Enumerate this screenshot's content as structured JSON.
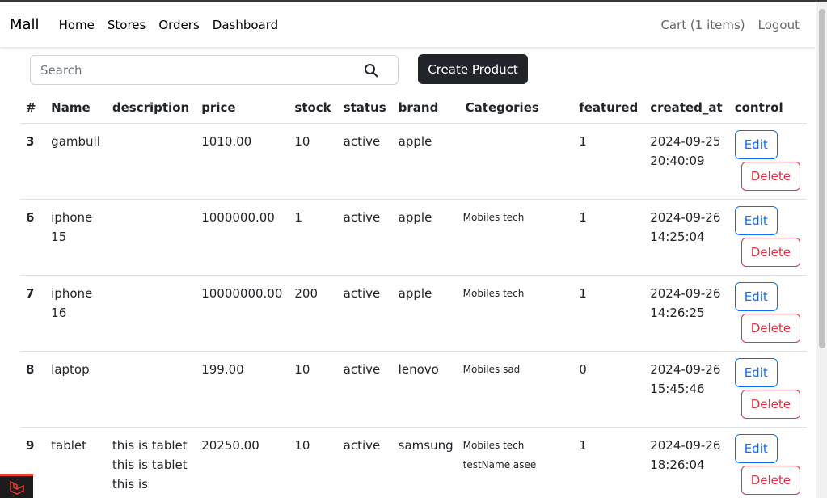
{
  "navbar": {
    "brand": "Mall",
    "links": [
      "Home",
      "Stores",
      "Orders",
      "Dashboard"
    ],
    "cart": "Cart (1 items)",
    "logout": "Logout"
  },
  "search": {
    "placeholder": "Search",
    "value": ""
  },
  "create_button": "Create Product",
  "table": {
    "headers": [
      "#",
      "Name",
      "description",
      "price",
      "stock",
      "status",
      "brand",
      "Categories",
      "featured",
      "created_at",
      "control"
    ],
    "rows": [
      {
        "id": "3",
        "name": "gambull",
        "description": "",
        "price": "1010.00",
        "stock": "10",
        "status": "active",
        "brand": "apple",
        "categories": "",
        "featured": "1",
        "created_at": "2024-09-25 20:40:09"
      },
      {
        "id": "6",
        "name": "iphone 15",
        "description": "",
        "price": "1000000.00",
        "stock": "1",
        "status": "active",
        "brand": "apple",
        "categories": "Mobiles tech",
        "featured": "1",
        "created_at": "2024-09-26 14:25:04"
      },
      {
        "id": "7",
        "name": "iphone 16",
        "description": "",
        "price": "10000000.00",
        "stock": "200",
        "status": "active",
        "brand": "apple",
        "categories": "Mobiles tech",
        "featured": "1",
        "created_at": "2024-09-26 14:26:25"
      },
      {
        "id": "8",
        "name": "laptop",
        "description": "",
        "price": "199.00",
        "stock": "10",
        "status": "active",
        "brand": "lenovo",
        "categories": "Mobiles sad",
        "featured": "0",
        "created_at": "2024-09-26 15:45:46"
      },
      {
        "id": "9",
        "name": "tablet",
        "description": "this is tablet this is tablet this is",
        "price": "20250.00",
        "stock": "10",
        "status": "active",
        "brand": "samsung",
        "categories": "Mobiles tech testName asee",
        "featured": "1",
        "created_at": "2024-09-26 18:26:04"
      }
    ],
    "edit_label": "Edit",
    "delete_label": "Delete"
  }
}
